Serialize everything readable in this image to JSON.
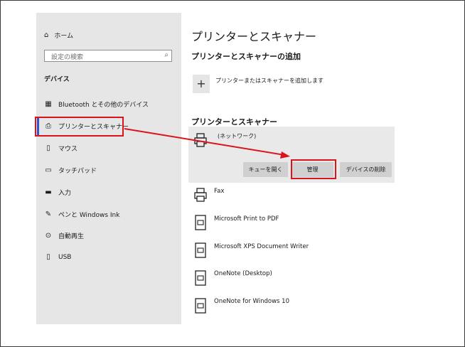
{
  "sidebar": {
    "home": "ホーム",
    "search_placeholder": "設定の検索",
    "section": "デバイス",
    "items": [
      {
        "label": "Bluetooth とその他のデバイス",
        "icon": "bluetooth-devices-icon"
      },
      {
        "label": "プリンターとスキャナー",
        "icon": "printer-icon"
      },
      {
        "label": "マウス",
        "icon": "mouse-icon"
      },
      {
        "label": "タッチパッド",
        "icon": "touchpad-icon"
      },
      {
        "label": "入力",
        "icon": "keyboard-icon"
      },
      {
        "label": "ペンと Windows Ink",
        "icon": "pen-icon"
      },
      {
        "label": "自動再生",
        "icon": "autoplay-icon"
      },
      {
        "label": "USB",
        "icon": "usb-icon"
      }
    ]
  },
  "main": {
    "title": "プリンターとスキャナー",
    "add_heading": "プリンターとスキャナーの追加",
    "add_button": "+",
    "add_label": "プリンターまたはスキャナーを追加します",
    "list_heading": "プリンターとスキャナー",
    "selected_printer": {
      "name": "(ネットワーク)",
      "buttons": [
        "キューを開く",
        "管理",
        "デバイスの削除"
      ]
    },
    "printers": [
      "Fax",
      "Microsoft Print to PDF",
      "Microsoft XPS Document Writer",
      "OneNote (Desktop)",
      "OneNote for Windows 10"
    ]
  },
  "colors": {
    "annotation_red": "#d9141c",
    "sidebar_bg": "#e6e6e6",
    "accent": "#3355cc"
  }
}
